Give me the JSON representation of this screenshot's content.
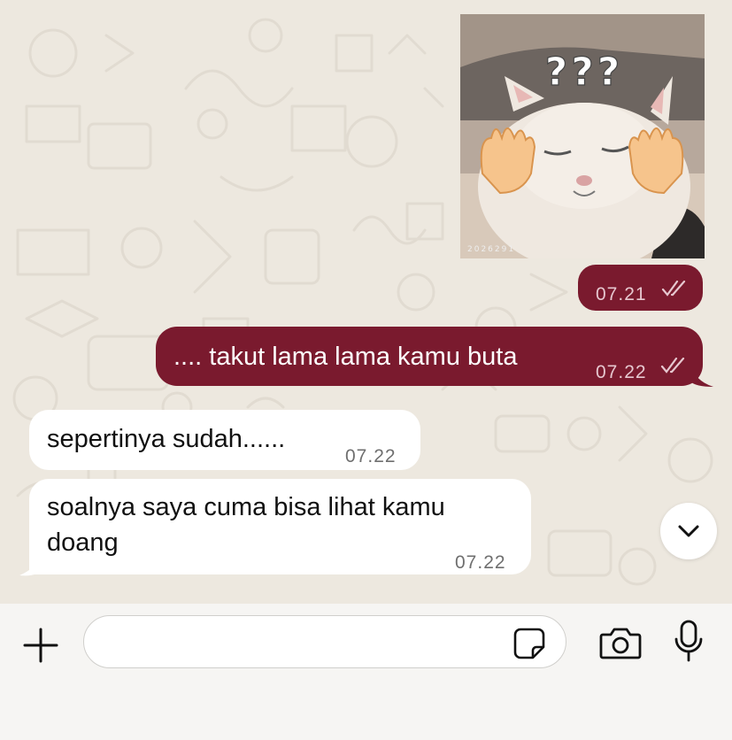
{
  "messages": {
    "sticker_time": "07.21",
    "outgoing_1": {
      "text": ".... takut lama lama kamu buta",
      "time": "07.22"
    },
    "incoming_1": {
      "text": "sepertinya sudah......",
      "time": "07.22"
    },
    "incoming_2": {
      "text": "soalnya saya cuma bisa lihat kamu doang",
      "time": "07.22"
    }
  },
  "sticker": {
    "text": "???",
    "watermark": "2026291"
  },
  "composer": {
    "placeholder": "",
    "value": ""
  },
  "colors": {
    "outgoing_bubble": "#7a1a2e",
    "incoming_bubble": "#ffffff",
    "background": "#ede8df"
  },
  "icons": [
    "double-check-icon",
    "chevron-down-icon",
    "plus-icon",
    "sticker-icon",
    "camera-icon",
    "microphone-icon"
  ]
}
